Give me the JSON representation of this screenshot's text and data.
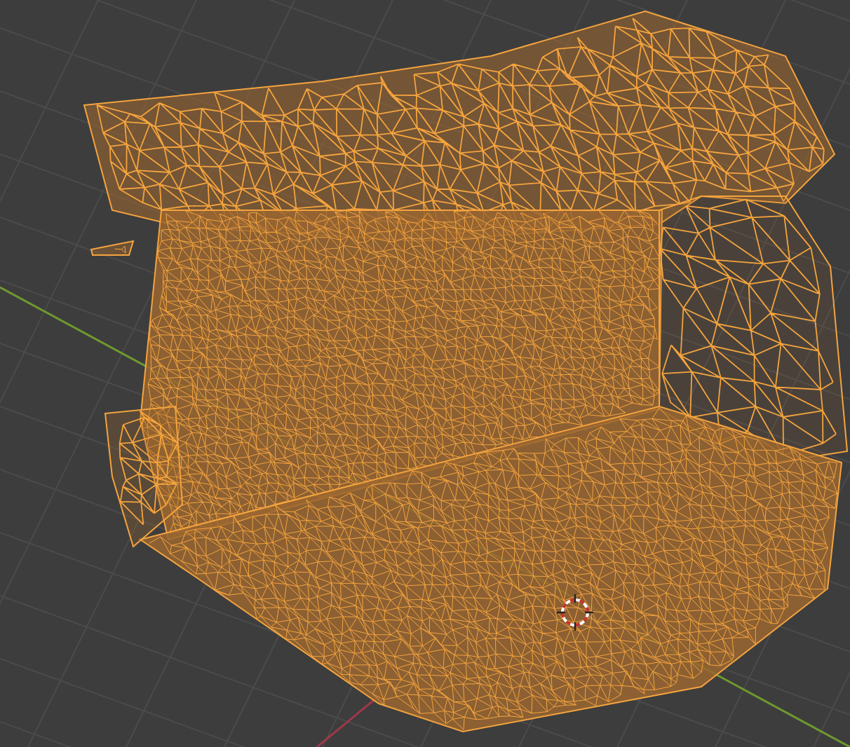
{
  "viewport": {
    "mesh": {
      "selected": true
    }
  }
}
